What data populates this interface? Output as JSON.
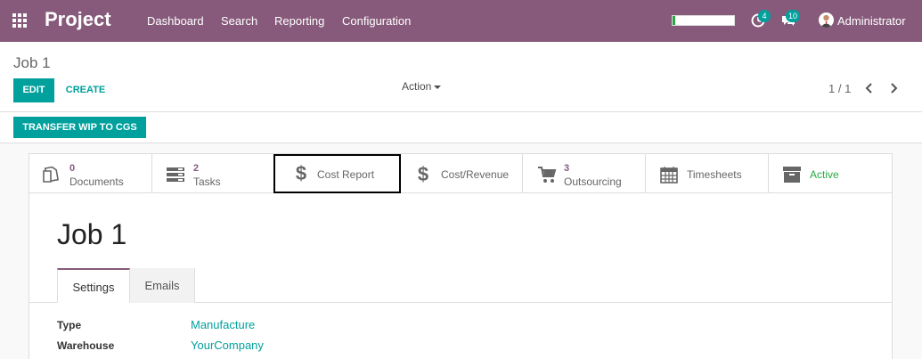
{
  "navbar": {
    "brand": "Project",
    "menu": [
      "Dashboard",
      "Search",
      "Reporting",
      "Configuration"
    ],
    "progress": 0.05,
    "activity_count": "4",
    "messages_count": "10",
    "user": "Administrator",
    "color": "#875a7b"
  },
  "control_panel": {
    "breadcrumb": "Job 1",
    "edit_label": "EDIT",
    "create_label": "CREATE",
    "action_label": "Action",
    "pager": "1 / 1",
    "transfer_label": "TRANSFER WIP TO CGS"
  },
  "smart_buttons": [
    {
      "value": "0",
      "label": "Documents",
      "icon": "documents-icon"
    },
    {
      "value": "2",
      "label": "Tasks",
      "icon": "tasks-icon"
    },
    {
      "value": "",
      "label": "Cost Report",
      "icon": "dollar-icon"
    },
    {
      "value": "",
      "label": "Cost/Revenue",
      "icon": "dollar-icon"
    },
    {
      "value": "3",
      "label": "Outsourcing",
      "icon": "cart-icon"
    },
    {
      "value": "",
      "label": "Timesheets",
      "icon": "calendar-icon"
    },
    {
      "value": "",
      "label": "Active",
      "icon": "archive-icon"
    }
  ],
  "form": {
    "title": "Job 1",
    "tabs": [
      "Settings",
      "Emails"
    ],
    "fields": [
      {
        "label": "Type",
        "value": "Manufacture"
      },
      {
        "label": "Warehouse",
        "value": "YourCompany"
      }
    ]
  },
  "colors": {
    "accent": "#00a09d",
    "brand": "#875a7b",
    "active_green": "#28a745"
  }
}
